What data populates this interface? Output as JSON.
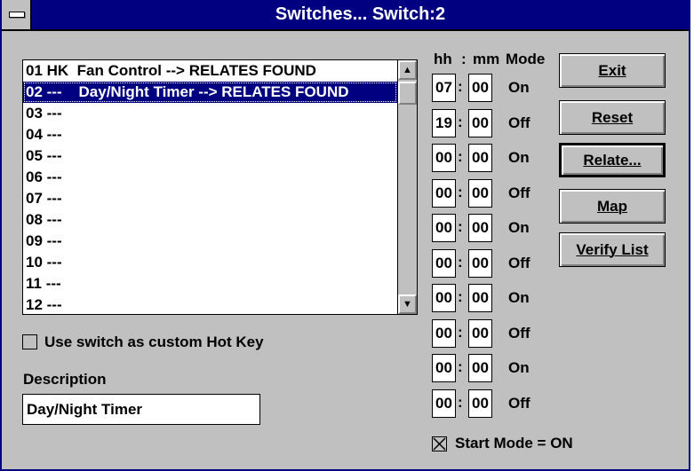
{
  "window": {
    "title": "Switches... Switch:2"
  },
  "switch_list": {
    "items": [
      "01 HK  Fan Control --> RELATES FOUND",
      "02 ---    Day/Night Timer --> RELATES FOUND",
      "03 ---",
      "04 ---",
      "05 ---",
      "06 ---",
      "07 ---",
      "08 ---",
      "09 ---",
      "10 ---",
      "11 ---",
      "12 ---"
    ],
    "selected_index": 1,
    "scroll_up_glyph": "▲",
    "scroll_down_glyph": "▼"
  },
  "hot_key_checkbox": {
    "label": "Use switch as custom Hot Key",
    "checked": false
  },
  "description": {
    "label": "Description",
    "value": "Day/Night Timer"
  },
  "timer_header": {
    "hh": "hh",
    "colon": ":",
    "mm": "mm",
    "mode": "Mode"
  },
  "timers": [
    {
      "hh": "07",
      "mm": "00",
      "mode": "On"
    },
    {
      "hh": "19",
      "mm": "00",
      "mode": "Off"
    },
    {
      "hh": "00",
      "mm": "00",
      "mode": "On"
    },
    {
      "hh": "00",
      "mm": "00",
      "mode": "Off"
    },
    {
      "hh": "00",
      "mm": "00",
      "mode": "On"
    },
    {
      "hh": "00",
      "mm": "00",
      "mode": "Off"
    },
    {
      "hh": "00",
      "mm": "00",
      "mode": "On"
    },
    {
      "hh": "00",
      "mm": "00",
      "mode": "Off"
    },
    {
      "hh": "00",
      "mm": "00",
      "mode": "On"
    },
    {
      "hh": "00",
      "mm": "00",
      "mode": "Off"
    }
  ],
  "start_mode": {
    "label": "Start Mode = ON",
    "checked": true
  },
  "buttons": {
    "exit": "Exit",
    "reset": "Reset",
    "relate": "Relate...",
    "map": "Map",
    "verify": "Verify List"
  },
  "colors": {
    "titlebar": "#000080",
    "face": "#c0c0c0",
    "selection": "#000080"
  }
}
